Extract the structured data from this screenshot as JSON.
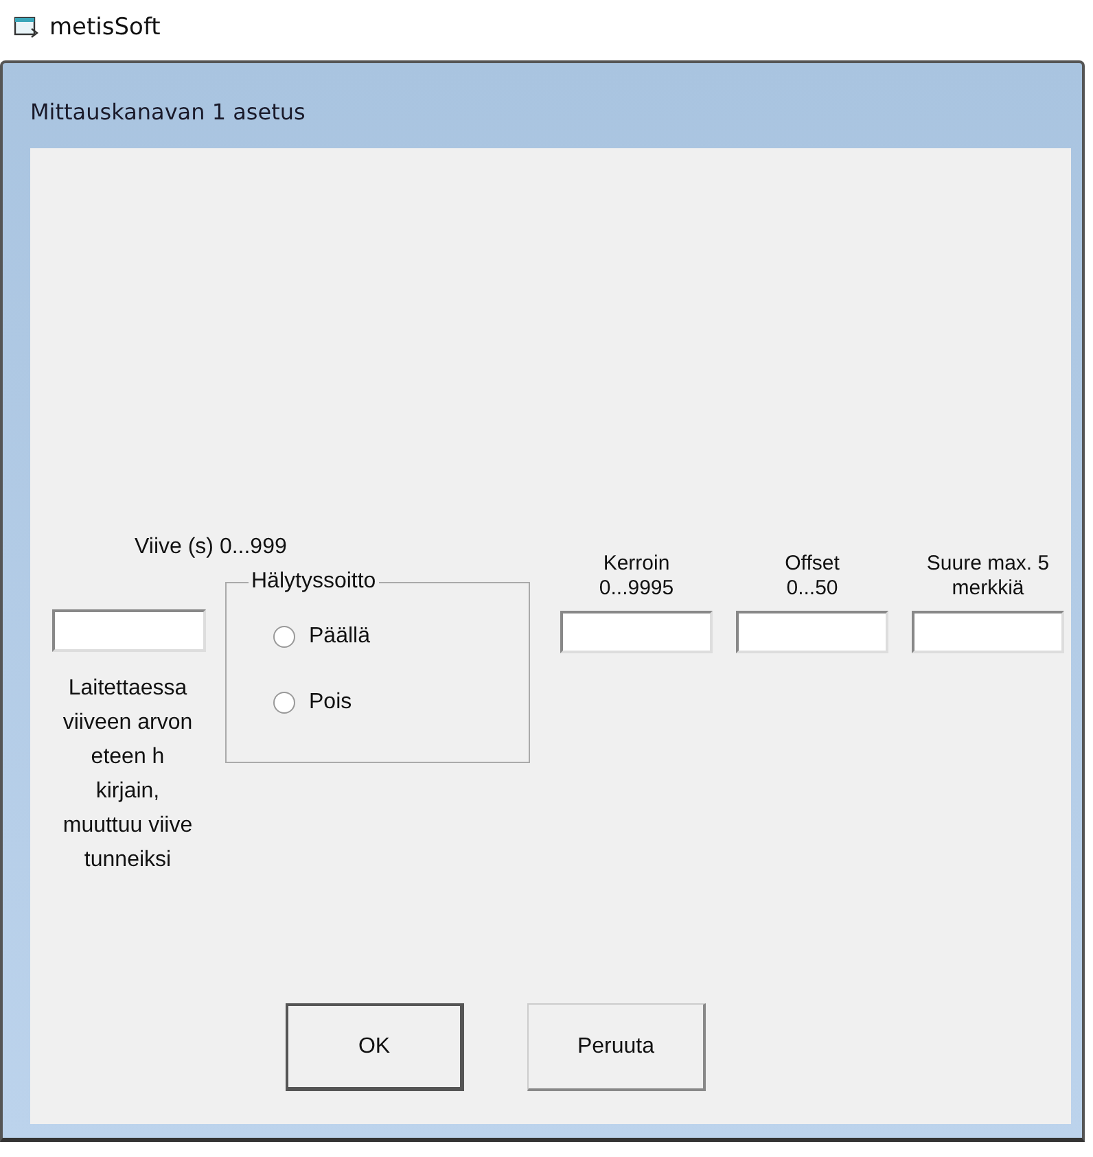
{
  "app": {
    "title": "metisSoft"
  },
  "dialog": {
    "title": "Mittauskanavan 1 asetus"
  },
  "delay": {
    "label": "Viive (s) 0...999",
    "help": "Laitettaessa\nviiveen arvon\neteen h\nkirjain,\nmuuttuu viive\ntunneiksi"
  },
  "alarm_call": {
    "label": "Hälytyssoitto",
    "options": [
      {
        "label": "Päällä",
        "selected": false
      },
      {
        "label": "Pois",
        "selected": false
      }
    ]
  },
  "fields": [
    {
      "label": "Kerroin\n0...9995"
    },
    {
      "label": "Offset\n0...50"
    },
    {
      "label": "Suure max. 5\nmerkkiä"
    }
  ],
  "buttons": [
    {
      "label": "OK",
      "default": true
    },
    {
      "label": "Peruuta",
      "default": false
    }
  ]
}
